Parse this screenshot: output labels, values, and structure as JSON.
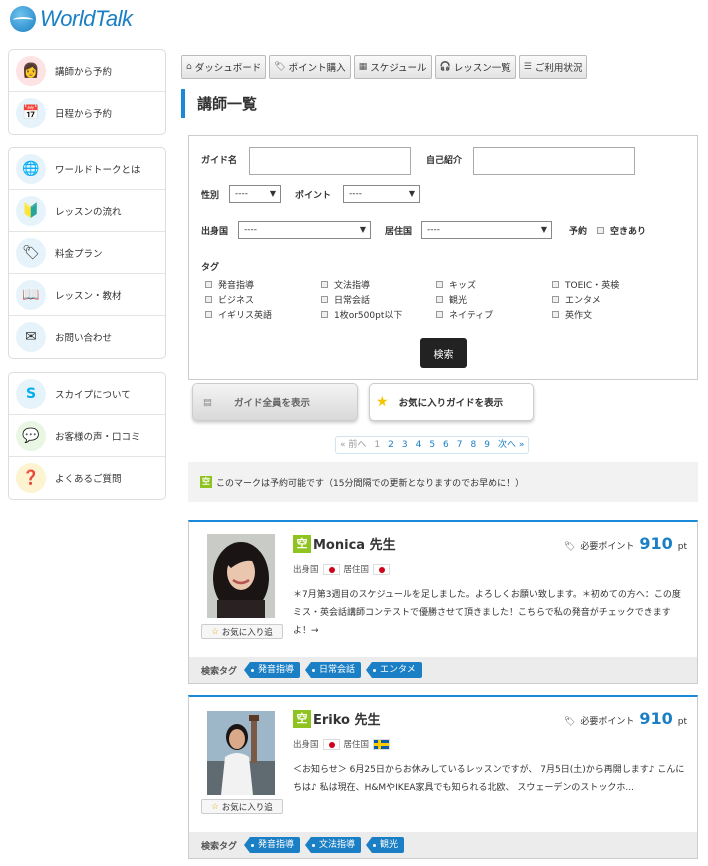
{
  "logo": "WorldTalk",
  "sidebar": {
    "group1": [
      {
        "label": "講師から予約",
        "icon": "person-icon"
      },
      {
        "label": "日程から予約",
        "icon": "calendar-icon"
      }
    ],
    "group2": [
      {
        "label": "ワールドトークとは",
        "icon": "globe-icon"
      },
      {
        "label": "レッスンの流れ",
        "icon": "leaf-icon"
      },
      {
        "label": "料金プラン",
        "icon": "price-tag-icon"
      },
      {
        "label": "レッスン・教材",
        "icon": "book-icon"
      },
      {
        "label": "お問い合わせ",
        "icon": "mail-icon"
      }
    ],
    "group3": [
      {
        "label": "スカイプについて",
        "icon": "skype-icon"
      },
      {
        "label": "お客様の声・口コミ",
        "icon": "voice-icon"
      },
      {
        "label": "よくあるご質問",
        "icon": "question-icon"
      }
    ]
  },
  "nav": [
    {
      "label": "ダッシュボード",
      "icon": "home-icon"
    },
    {
      "label": "ポイント購入",
      "icon": "tag-icon"
    },
    {
      "label": "スケジュール",
      "icon": "calendar-icon"
    },
    {
      "label": "レッスン一覧",
      "icon": "headset-icon"
    },
    {
      "label": "ご利用状況",
      "icon": "list-icon"
    }
  ],
  "page_title": "講師一覧",
  "search": {
    "guide_name_label": "ガイド名",
    "self_intro_label": "自己紹介",
    "gender_label": "性別",
    "gender_value": "----",
    "point_label": "ポイント",
    "point_value": "----",
    "origin_label": "出身国",
    "origin_value": "----",
    "residence_label": "居住国",
    "residence_value": "----",
    "reserve_label": "予約",
    "available_label": "空きあり",
    "tag_label": "タグ",
    "tags": [
      "発音指導",
      "文法指導",
      "キッズ",
      "TOEIC・英検",
      "ビジネス",
      "日常会話",
      "観光",
      "エンタメ",
      "イギリス英語",
      "1枚or500pt以下",
      "ネイティブ",
      "英作文"
    ],
    "submit": "検索"
  },
  "show_all": "ガイド全員を表示",
  "show_fav": "お気に入りガイドを表示",
  "pager": {
    "prev": "« 前へ",
    "pages": [
      "1",
      "2",
      "3",
      "4",
      "5",
      "6",
      "7",
      "8",
      "9"
    ],
    "next": "次へ »"
  },
  "notice": "このマークは予約可能です（15分間隔での更新となりますのでお早めに！）",
  "kara_mark": "空",
  "labels": {
    "points": "必要ポイント",
    "pt": "pt",
    "origin": "出身国",
    "residence": "居住国",
    "fav": "お気に入り追",
    "search_tags": "検索タグ"
  },
  "teachers": [
    {
      "name": "Monica 先生",
      "points": "910",
      "desc": "＊7月第3週目のスケジュールを足しました。よろしくお願い致します。＊初めての方へ：この度ミス・英会話講師コンテストで優勝させて頂きました！こちらで私の発音がチェックできますよ！→",
      "tags": [
        "発音指導",
        "日常会話",
        "エンタメ"
      ]
    },
    {
      "name": "Eriko 先生",
      "points": "910",
      "desc": "＜お知らせ＞ 6月25日からお休みしているレッスンですが、 7月5日(土)から再開します♪ こんにちは♪ 私は現在、H&MやIKEA家具でも知られる北欧、 スウェーデンのストックホ...",
      "tags": [
        "発音指導",
        "文法指導",
        "観光"
      ]
    }
  ]
}
